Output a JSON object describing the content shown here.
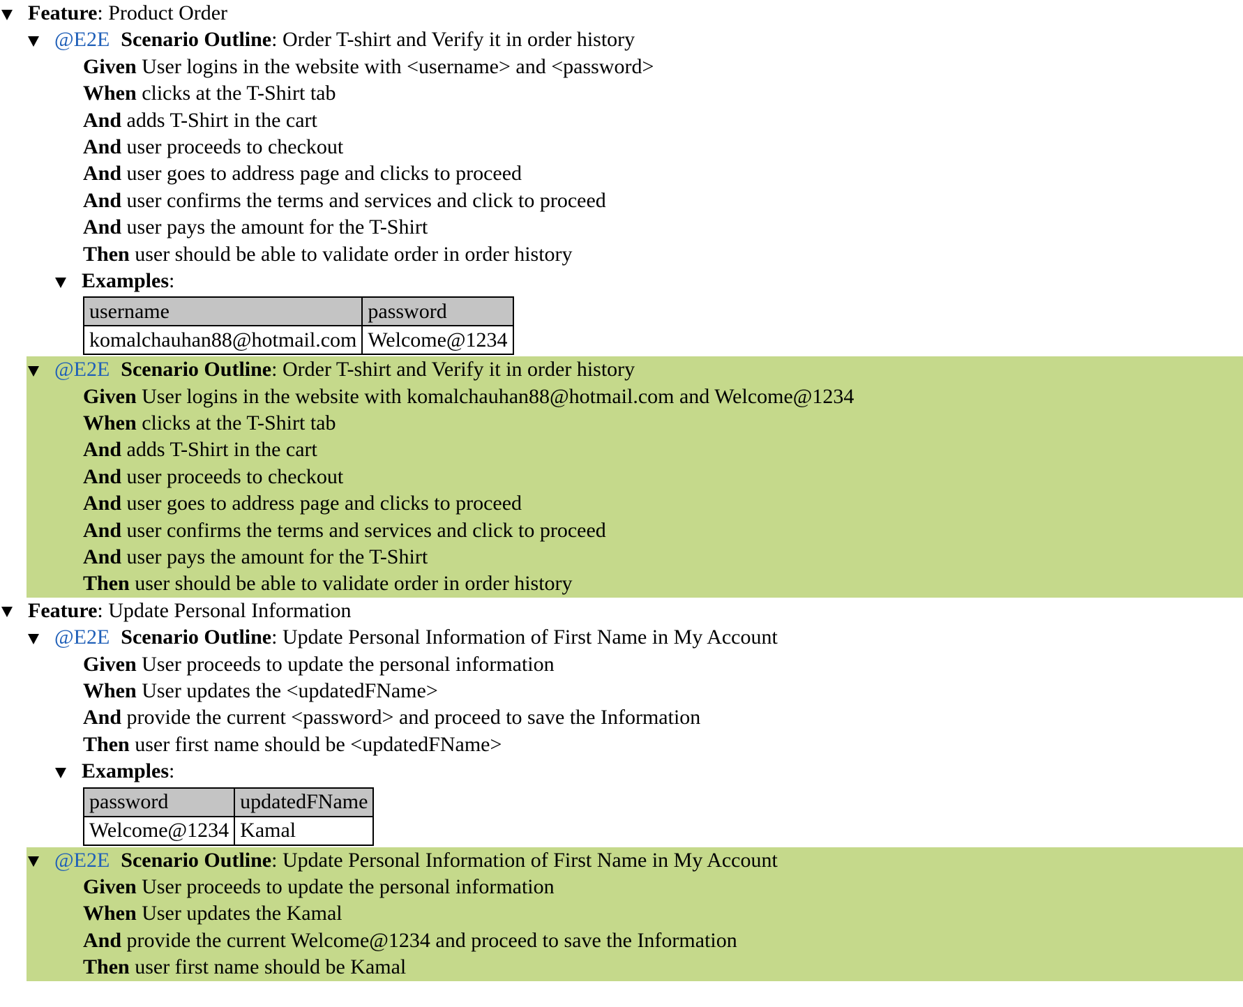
{
  "features": [
    {
      "keyword": "Feature",
      "name": "Product Order",
      "outline": {
        "tag": "@E2E",
        "keyword": "Scenario Outline",
        "name": "Order T-shirt and Verify it in order history",
        "steps": [
          {
            "keyword": "Given",
            "text": "User logins in the website with <username> and <password>"
          },
          {
            "keyword": "When",
            "text": "clicks at the T-Shirt tab"
          },
          {
            "keyword": "And",
            "text": "adds T-Shirt in the cart"
          },
          {
            "keyword": "And",
            "text": "user proceeds to checkout"
          },
          {
            "keyword": "And",
            "text": "user goes to address page and clicks to proceed"
          },
          {
            "keyword": "And",
            "text": "user confirms the terms and services and click to proceed"
          },
          {
            "keyword": "And",
            "text": "user pays the amount for the T-Shirt"
          },
          {
            "keyword": "Then",
            "text": "user should be able to validate order in order history"
          }
        ],
        "examples": {
          "keyword": "Examples",
          "headers": [
            "username",
            "password"
          ],
          "rows": [
            [
              "komalchauhan88@hotmail.com",
              "Welcome@1234"
            ]
          ]
        }
      },
      "executed": {
        "status": "passed",
        "status_color": "#c5d98b",
        "tag": "@E2E",
        "keyword": "Scenario Outline",
        "name": "Order T-shirt and Verify it in order history",
        "steps": [
          {
            "keyword": "Given",
            "text": "User logins in the website with komalchauhan88@hotmail.com and Welcome@1234"
          },
          {
            "keyword": "When",
            "text": "clicks at the T-Shirt tab"
          },
          {
            "keyword": "And",
            "text": "adds T-Shirt in the cart"
          },
          {
            "keyword": "And",
            "text": "user proceeds to checkout"
          },
          {
            "keyword": "And",
            "text": "user goes to address page and clicks to proceed"
          },
          {
            "keyword": "And",
            "text": "user confirms the terms and services and click to proceed"
          },
          {
            "keyword": "And",
            "text": "user pays the amount for the T-Shirt"
          },
          {
            "keyword": "Then",
            "text": "user should be able to validate order in order history"
          }
        ]
      }
    },
    {
      "keyword": "Feature",
      "name": "Update Personal Information",
      "outline": {
        "tag": "@E2E",
        "keyword": "Scenario Outline",
        "name": "Update Personal Information of First Name in My Account",
        "steps": [
          {
            "keyword": "Given",
            "text": "User proceeds to update the personal information"
          },
          {
            "keyword": "When",
            "text": "User updates the <updatedFName>"
          },
          {
            "keyword": "And",
            "text": "provide the current <password> and proceed to save the Information"
          },
          {
            "keyword": "Then",
            "text": "user first name should be <updatedFName>"
          }
        ],
        "examples": {
          "keyword": "Examples",
          "headers": [
            "password",
            "updatedFName"
          ],
          "rows": [
            [
              "Welcome@1234",
              "Kamal"
            ]
          ]
        }
      },
      "executed": {
        "status": "passed",
        "status_color": "#c5d98b",
        "tag": "@E2E",
        "keyword": "Scenario Outline",
        "name": "Update Personal Information of First Name in My Account",
        "steps": [
          {
            "keyword": "Given",
            "text": "User proceeds to update the personal information"
          },
          {
            "keyword": "When",
            "text": "User updates the Kamal"
          },
          {
            "keyword": "And",
            "text": "provide the current Welcome@1234 and proceed to save the Information"
          },
          {
            "keyword": "Then",
            "text": "user first name should be Kamal"
          }
        ]
      }
    }
  ],
  "colors": {
    "tag": "#1f5fb8",
    "passed_background": "#c5d98b",
    "table_header_background": "#c4c4c4"
  },
  "icons": {
    "toggle": "disclosure-triangle-down-icon"
  }
}
